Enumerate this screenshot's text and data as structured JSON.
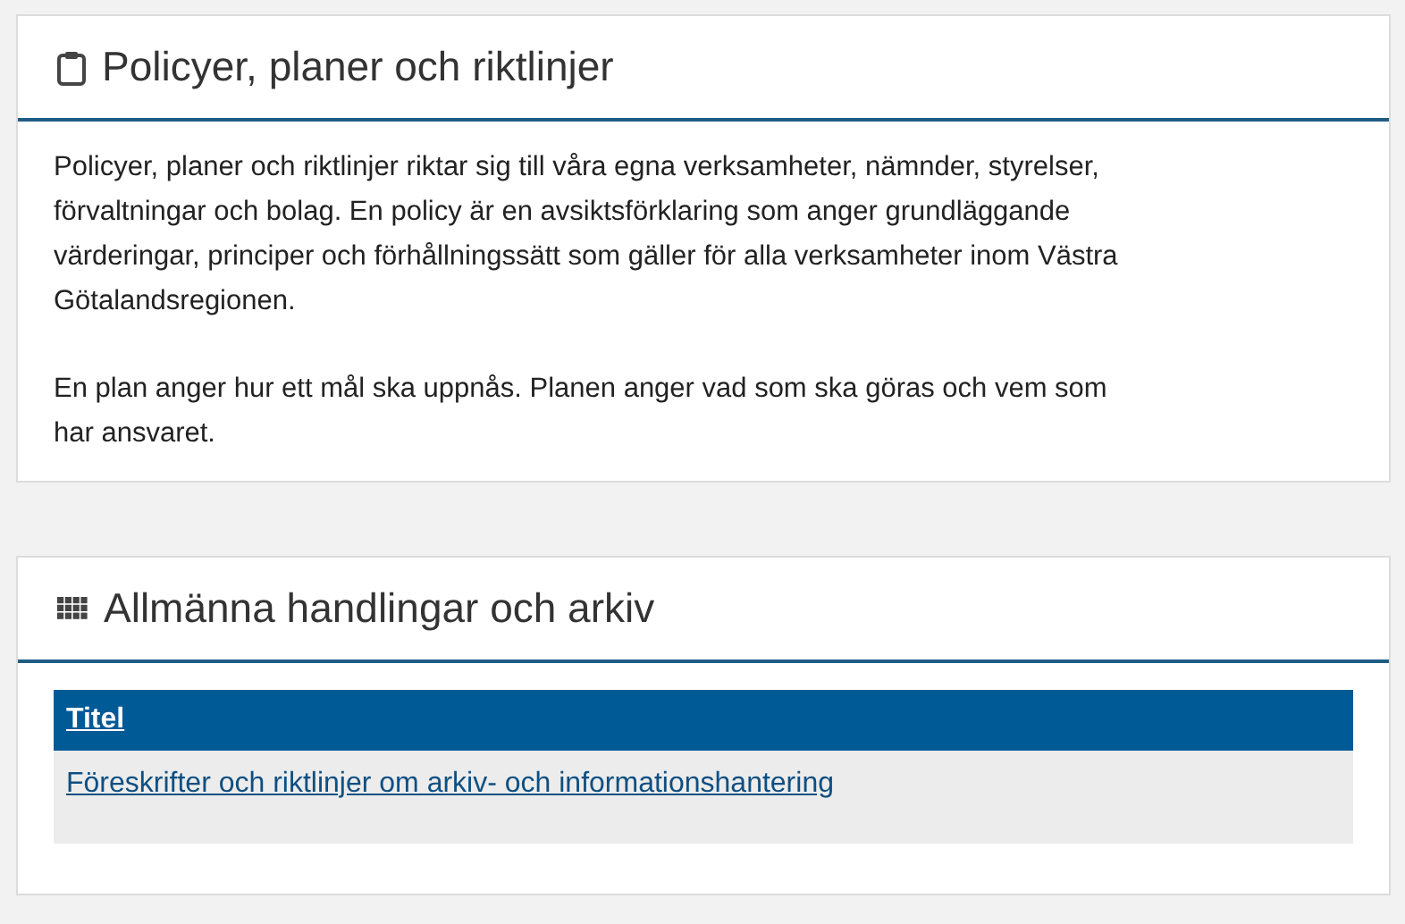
{
  "panels": [
    {
      "kind": "text",
      "title": "Policyer, planer och riktlinjer",
      "paragraphs": [
        "Policyer, planer och riktlinjer riktar sig till våra egna verksamheter, nämnder, styrelser, förvaltningar och bolag. En policy är en avsiktsförklaring som anger grundläggande värderingar, principer och förhållningssätt som gäller för alla verksamheter inom Västra Götalandsregionen.",
        "En plan anger hur ett mål ska uppnås. Planen anger vad som ska göras och vem som har ansvaret."
      ]
    },
    {
      "kind": "table",
      "title": "Allmänna handlingar och arkiv",
      "columns": [
        "Titel"
      ],
      "rows": [
        [
          "Föreskrifter och riktlinjer om arkiv- och informationshantering"
        ]
      ]
    }
  ]
}
